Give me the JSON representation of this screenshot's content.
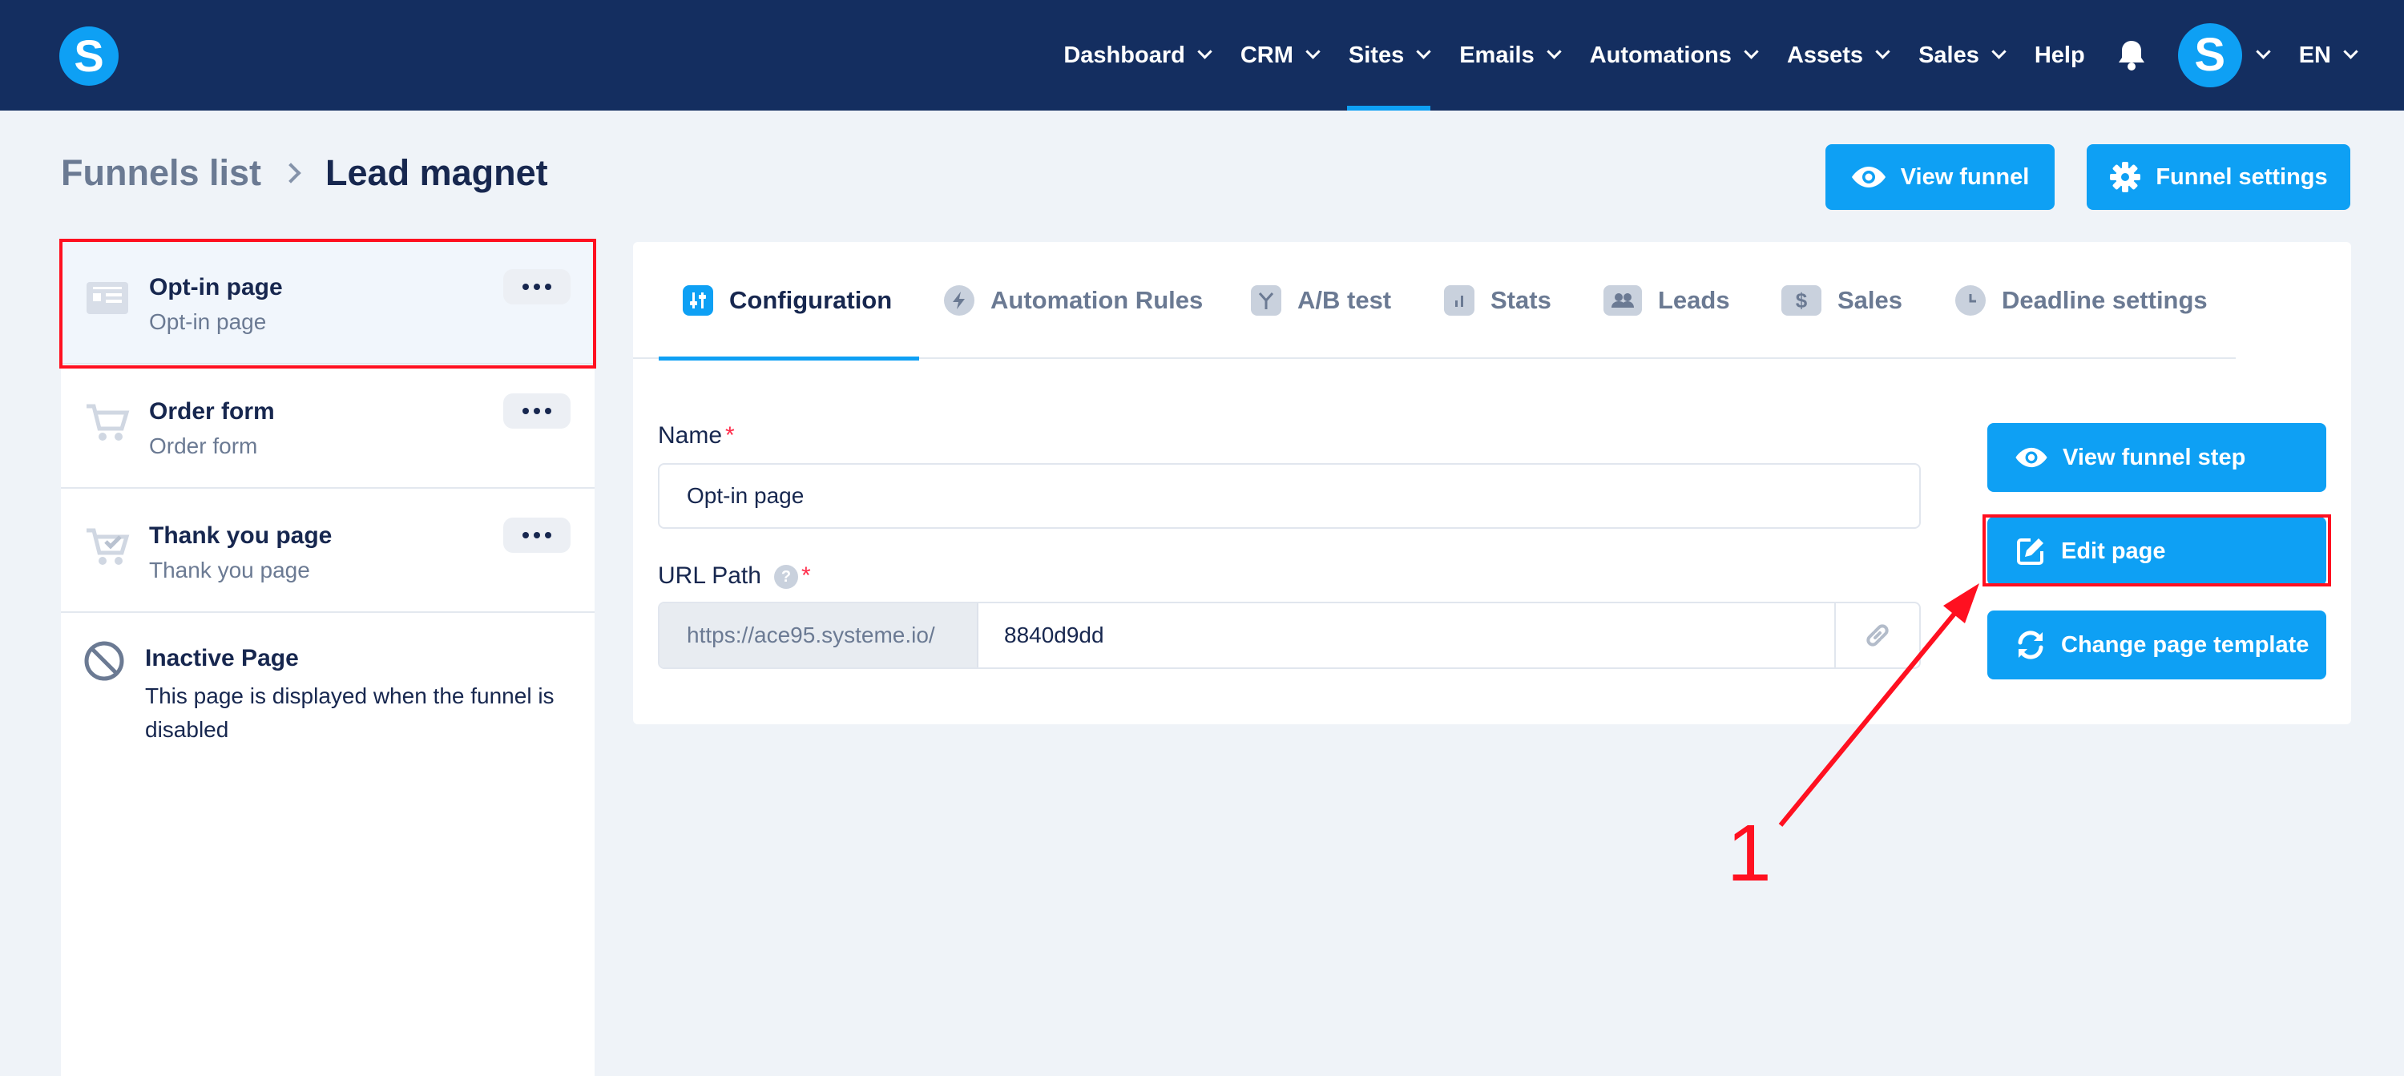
{
  "nav": {
    "logo": "S",
    "items": [
      {
        "label": "Dashboard",
        "dropdown": true,
        "active": false
      },
      {
        "label": "CRM",
        "dropdown": true,
        "active": false
      },
      {
        "label": "Sites",
        "dropdown": true,
        "active": true
      },
      {
        "label": "Emails",
        "dropdown": true,
        "active": false
      },
      {
        "label": "Automations",
        "dropdown": true,
        "active": false
      },
      {
        "label": "Assets",
        "dropdown": true,
        "active": false
      },
      {
        "label": "Sales",
        "dropdown": true,
        "active": false
      },
      {
        "label": "Help",
        "dropdown": false,
        "active": false
      }
    ],
    "avatar": "S",
    "language": "EN"
  },
  "breadcrumb": {
    "parent": "Funnels list",
    "current": "Lead magnet"
  },
  "header_buttons": {
    "view_funnel": "View funnel",
    "funnel_settings": "Funnel settings"
  },
  "sidebar": {
    "steps": [
      {
        "title": "Opt-in page",
        "subtitle": "Opt-in page",
        "icon": "page-icon",
        "selected": true
      },
      {
        "title": "Order form",
        "subtitle": "Order form",
        "icon": "cart-icon",
        "selected": false
      },
      {
        "title": "Thank you page",
        "subtitle": "Thank you page",
        "icon": "cart-check-icon",
        "selected": false
      }
    ],
    "inactive": {
      "title": "Inactive Page",
      "description": "This page is displayed when the funnel is disabled"
    }
  },
  "tabs": [
    {
      "label": "Configuration",
      "icon": "sliders-icon",
      "active": true
    },
    {
      "label": "Automation Rules",
      "icon": "bolt-icon",
      "active": false
    },
    {
      "label": "A/B test",
      "icon": "split-icon",
      "active": false
    },
    {
      "label": "Stats",
      "icon": "bar-chart-icon",
      "active": false
    },
    {
      "label": "Leads",
      "icon": "users-icon",
      "active": false
    },
    {
      "label": "Sales",
      "icon": "dollar-icon",
      "active": false
    },
    {
      "label": "Deadline settings",
      "icon": "clock-icon",
      "active": false
    }
  ],
  "form": {
    "name_label": "Name",
    "name_value": "Opt-in page",
    "url_label": "URL Path",
    "url_prefix": "https://ace95.systeme.io/",
    "url_value": "8840d9dd",
    "required_mark": "*",
    "help_mark": "?"
  },
  "actions": {
    "view_step": "View funnel step",
    "edit_page": "Edit page",
    "change_template": "Change page template"
  },
  "annotation": {
    "number": "1"
  },
  "colors": {
    "nav_bg": "#142e60",
    "accent": "#0ea0f4",
    "annotation_red": "#ff1020",
    "page_bg": "#eff3f8"
  }
}
